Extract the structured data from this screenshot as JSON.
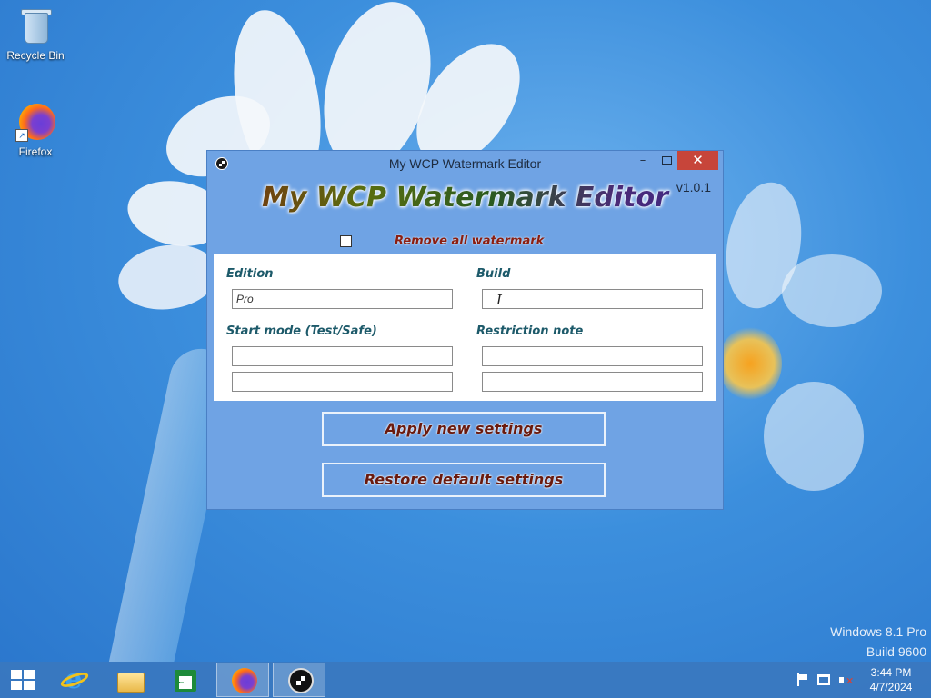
{
  "desktop": {
    "icons": [
      {
        "label": "Recycle Bin",
        "icon": "recycle-bin-icon"
      },
      {
        "label": "Firefox",
        "icon": "firefox-icon"
      }
    ],
    "watermark": {
      "line1": "Windows 8.1 Pro",
      "line2": "Build 9600"
    }
  },
  "window": {
    "title": "My WCP Watermark Editor",
    "controls": {
      "minimize": "–",
      "close": "✕"
    },
    "app_title": "My WCP Watermark Editor",
    "version": "v1.0.1",
    "remove_all": {
      "label": "Remove all watermark",
      "checked": false
    },
    "fields": {
      "edition": {
        "label": "Edition",
        "value": "Pro"
      },
      "build": {
        "label": "Build",
        "value": ""
      },
      "start_mode": {
        "label": "Start mode (Test/Safe)",
        "value1": "",
        "value2": ""
      },
      "restriction": {
        "label": "Restriction note",
        "value1": "",
        "value2": ""
      }
    },
    "buttons": {
      "apply": "Apply new settings",
      "restore": "Restore default settings"
    }
  },
  "taskbar": {
    "pinned": [
      {
        "name": "Internet Explorer",
        "icon": "internet-explorer-icon"
      },
      {
        "name": "File Explorer",
        "icon": "file-explorer-icon"
      },
      {
        "name": "Store",
        "icon": "store-icon"
      },
      {
        "name": "Firefox",
        "icon": "firefox-icon",
        "active": true
      },
      {
        "name": "My WCP Watermark Editor",
        "icon": "wcp-editor-icon",
        "active": true
      }
    ],
    "clock": {
      "time": "3:44 PM",
      "date": "4/7/2024"
    }
  },
  "colors": {
    "window_bg": "#6fa3e4",
    "close_button": "#c7453a",
    "field_label": "#1d5a6a",
    "button_text": "#6a1a0e",
    "taskbar": "#3a78be"
  }
}
